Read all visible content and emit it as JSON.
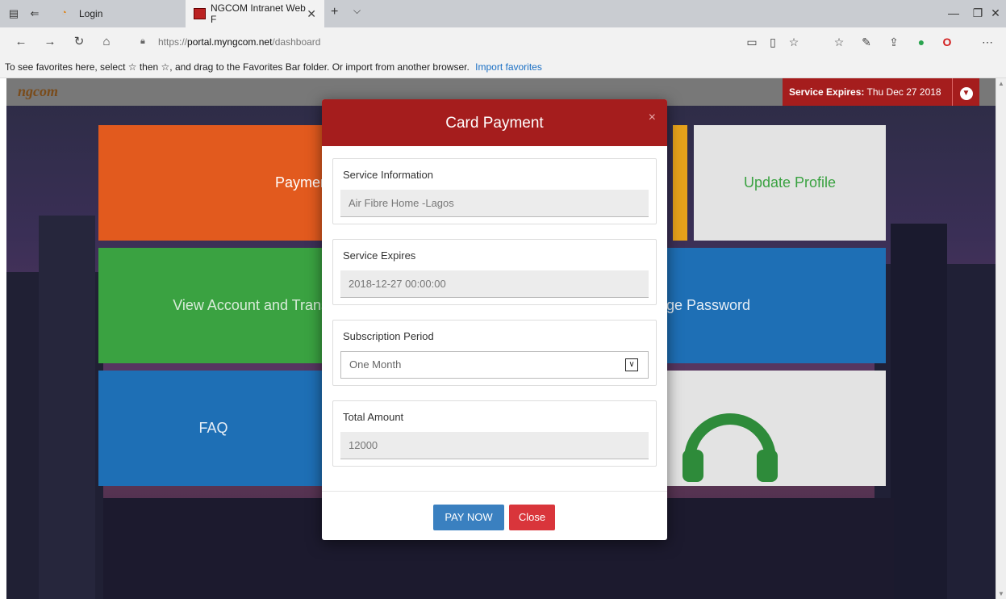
{
  "browser": {
    "tabs": [
      {
        "label": "Login"
      },
      {
        "label": "NGCOM Intranet Web F"
      }
    ],
    "url_scheme": "https://",
    "url_host": "portal.myngcom.net",
    "url_path": "/dashboard",
    "favorites_text": "To see favorites here, select ☆ then ☆, and drag to the Favorites Bar folder. Or import from another browser.",
    "favorites_link": "Import favorites"
  },
  "header": {
    "brand": "ngcom",
    "expires_label": "Service Expires:",
    "expires_value": " Thu Dec 27 2018"
  },
  "tiles": {
    "payment": "Paymen",
    "update": "Update Profile",
    "view": "View Account and Trans",
    "password": "ge Password",
    "faq": "FAQ"
  },
  "modal": {
    "title": "Card Payment",
    "close_glyph": "×",
    "fields": [
      {
        "label": "Service Information",
        "value": "Air Fibre Home -Lagos"
      },
      {
        "label": "Service Expires",
        "value": "2018-12-27 00:00:00"
      },
      {
        "label": "Subscription Period",
        "value": "One Month"
      },
      {
        "label": "Total Amount",
        "value": "12000"
      }
    ],
    "pay_label": "PAY NOW",
    "close_label": "Close"
  },
  "colors": {
    "brand_red": "#a51d1d",
    "pay_blue": "#3a80c0",
    "close_red": "#d9353b"
  }
}
